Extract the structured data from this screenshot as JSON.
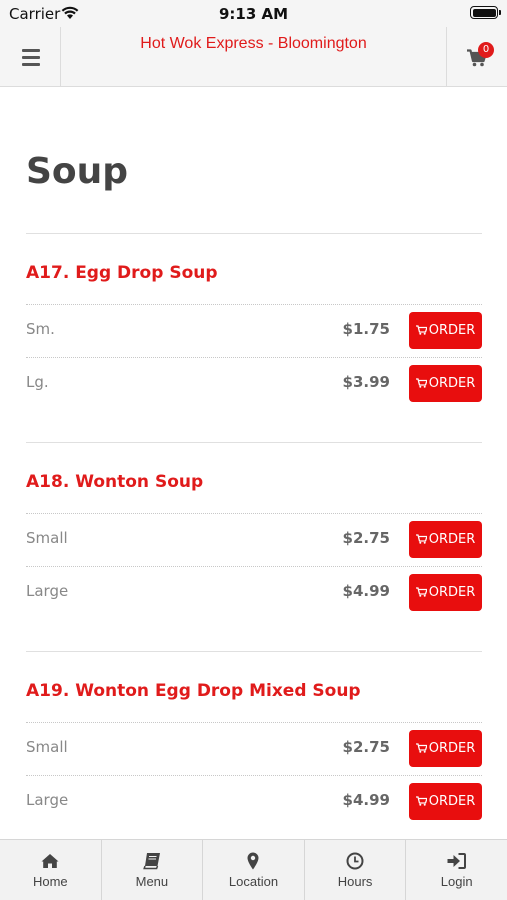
{
  "status_bar": {
    "carrier": "Carrier",
    "time": "9:13 AM"
  },
  "header": {
    "title": "Hot Wok Express - Bloomington",
    "cart_count": "0"
  },
  "page": {
    "title": "Soup"
  },
  "menu_items": [
    {
      "name": "A17. Egg Drop Soup",
      "options": [
        {
          "label": "Sm.",
          "price": "$1.75",
          "button": "ORDER"
        },
        {
          "label": "Lg.",
          "price": "$3.99",
          "button": "ORDER"
        }
      ]
    },
    {
      "name": "A18. Wonton Soup",
      "options": [
        {
          "label": "Small",
          "price": "$2.75",
          "button": "ORDER"
        },
        {
          "label": "Large",
          "price": "$4.99",
          "button": "ORDER"
        }
      ]
    },
    {
      "name": "A19. Wonton Egg Drop Mixed Soup",
      "options": [
        {
          "label": "Small",
          "price": "$2.75",
          "button": "ORDER"
        },
        {
          "label": "Large",
          "price": "$4.99",
          "button": "ORDER"
        }
      ]
    }
  ],
  "tab_bar": [
    {
      "label": "Home",
      "icon": "home-icon"
    },
    {
      "label": "Menu",
      "icon": "book-icon"
    },
    {
      "label": "Location",
      "icon": "map-marker-icon"
    },
    {
      "label": "Hours",
      "icon": "clock-icon"
    },
    {
      "label": "Login",
      "icon": "sign-in-icon"
    }
  ],
  "colors": {
    "brand_red": "#e01b1b",
    "button_red": "#e80e0e",
    "header_bg": "#f5f5f5"
  }
}
